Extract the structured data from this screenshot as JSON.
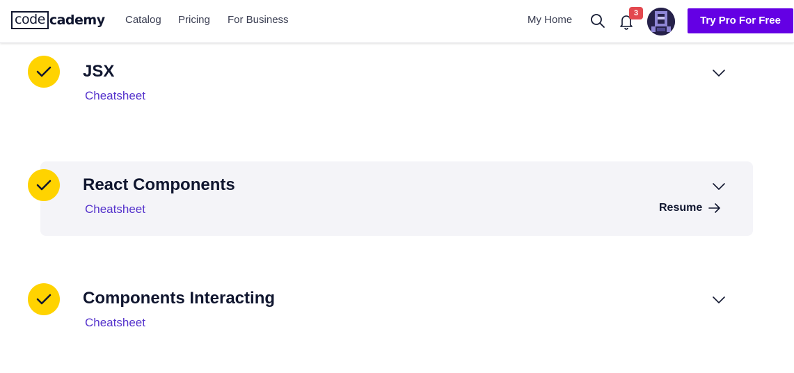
{
  "header": {
    "logo_left": "code",
    "logo_right": "cademy",
    "nav": [
      "Catalog",
      "Pricing",
      "For Business"
    ],
    "my_home": "My Home",
    "notifications_count": "3",
    "cta": "Try Pro For Free"
  },
  "modules": [
    {
      "title": "JSX",
      "cheatsheet": "Cheatsheet",
      "completed": true
    },
    {
      "title": "React Components",
      "cheatsheet": "Cheatsheet",
      "completed": true,
      "resume": "Resume"
    },
    {
      "title": "Components Interacting",
      "cheatsheet": "Cheatsheet",
      "completed": true
    }
  ],
  "colors": {
    "accent": "#6400e4",
    "check": "#ffd300",
    "link": "#5533cc",
    "badge": "#e3484f",
    "active_card": "#f4f4f8"
  },
  "icons": [
    "search-icon",
    "bell-icon",
    "check-icon",
    "chevron-down-icon",
    "arrow-right-icon"
  ]
}
